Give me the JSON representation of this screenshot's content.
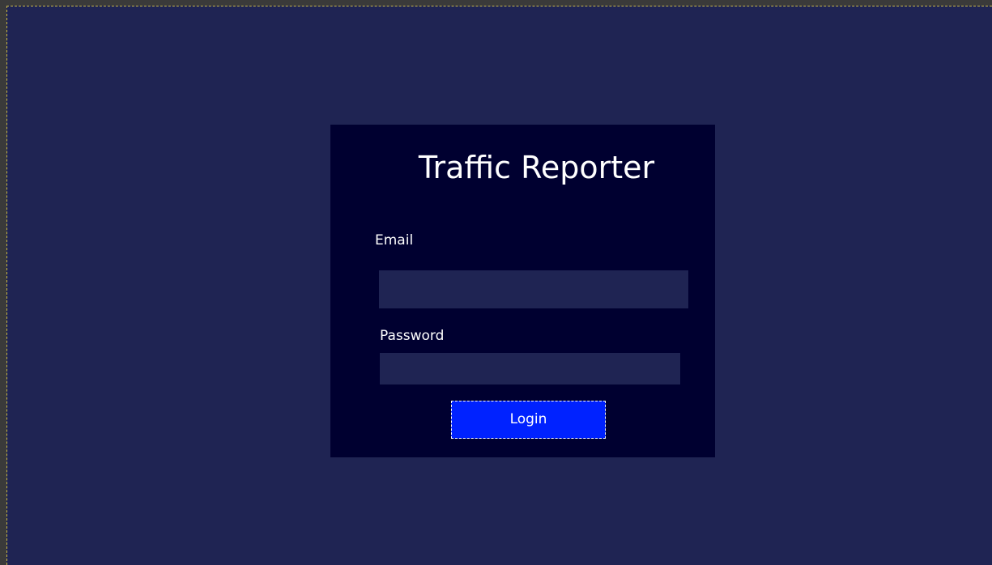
{
  "app": {
    "title": "Traffic Reporter"
  },
  "form": {
    "email_label": "Email",
    "email_value": "",
    "password_label": "Password",
    "password_value": "",
    "login_label": "Login"
  },
  "colors": {
    "page_background": "#1f2453",
    "card_background": "#000030",
    "field_background": "#1f2453",
    "button_background": "#0022ff",
    "text": "#ffffff",
    "frame": "#3a3a3a",
    "focus_outline": "#c9b84a"
  }
}
